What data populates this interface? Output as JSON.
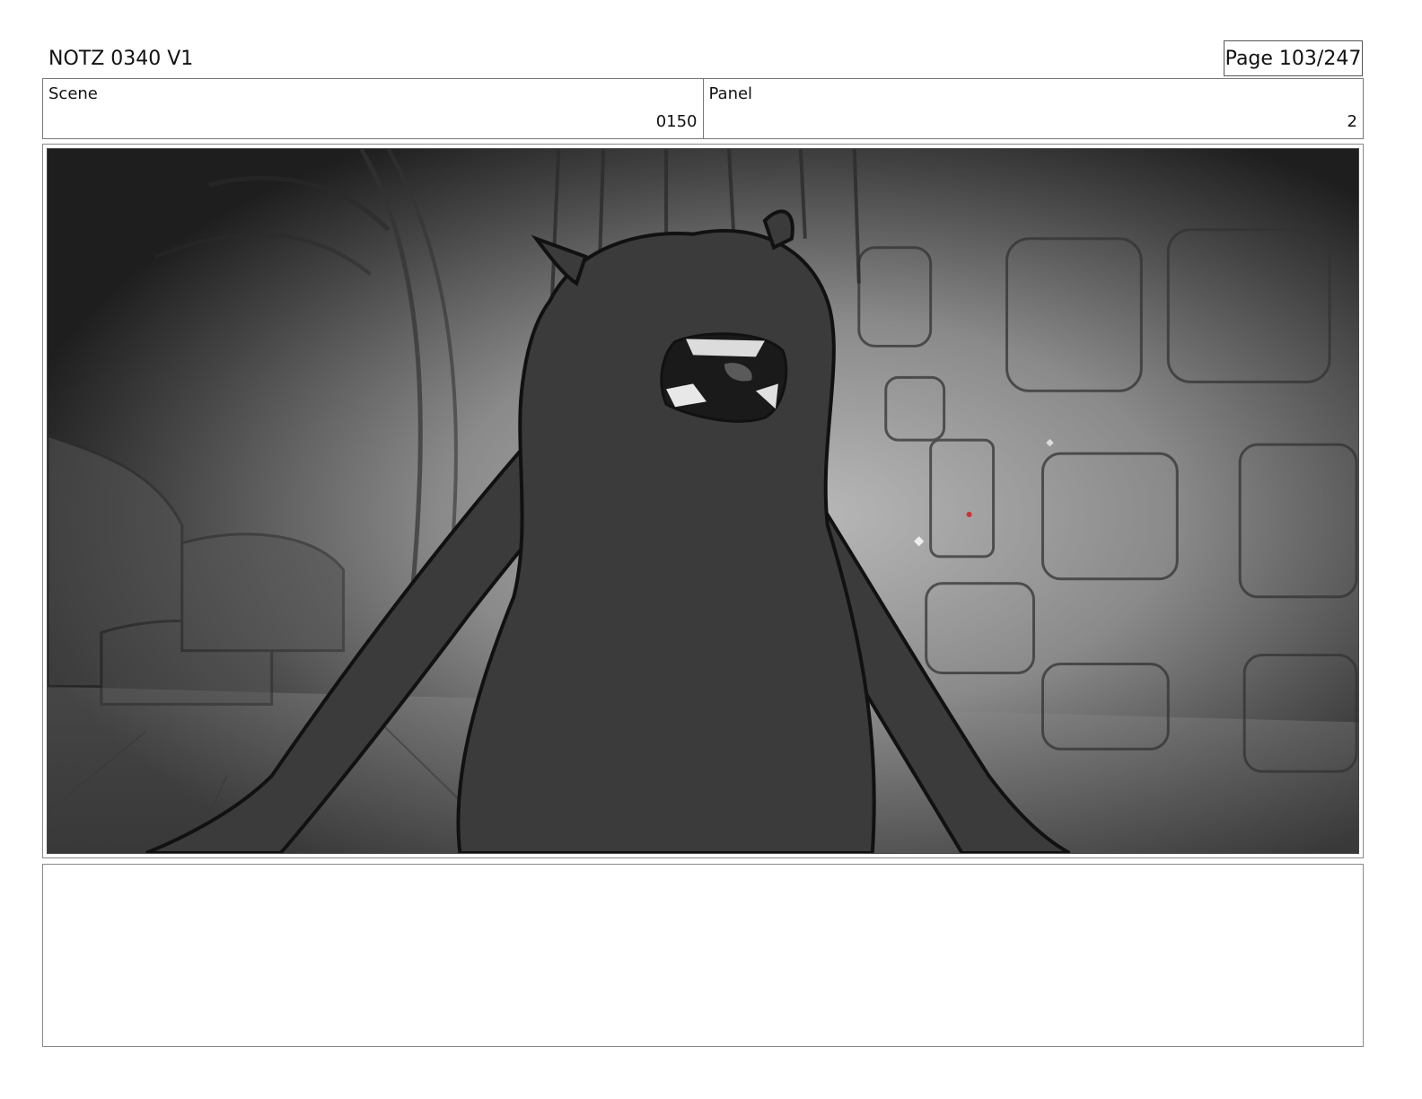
{
  "header": {
    "document_title": "NOTZ 0340 V1",
    "page_label": "Page 103/247"
  },
  "info": {
    "scene_label": "Scene",
    "scene_value": "0150",
    "panel_label": "Panel",
    "panel_value": "2"
  },
  "notes": {
    "text": ""
  }
}
